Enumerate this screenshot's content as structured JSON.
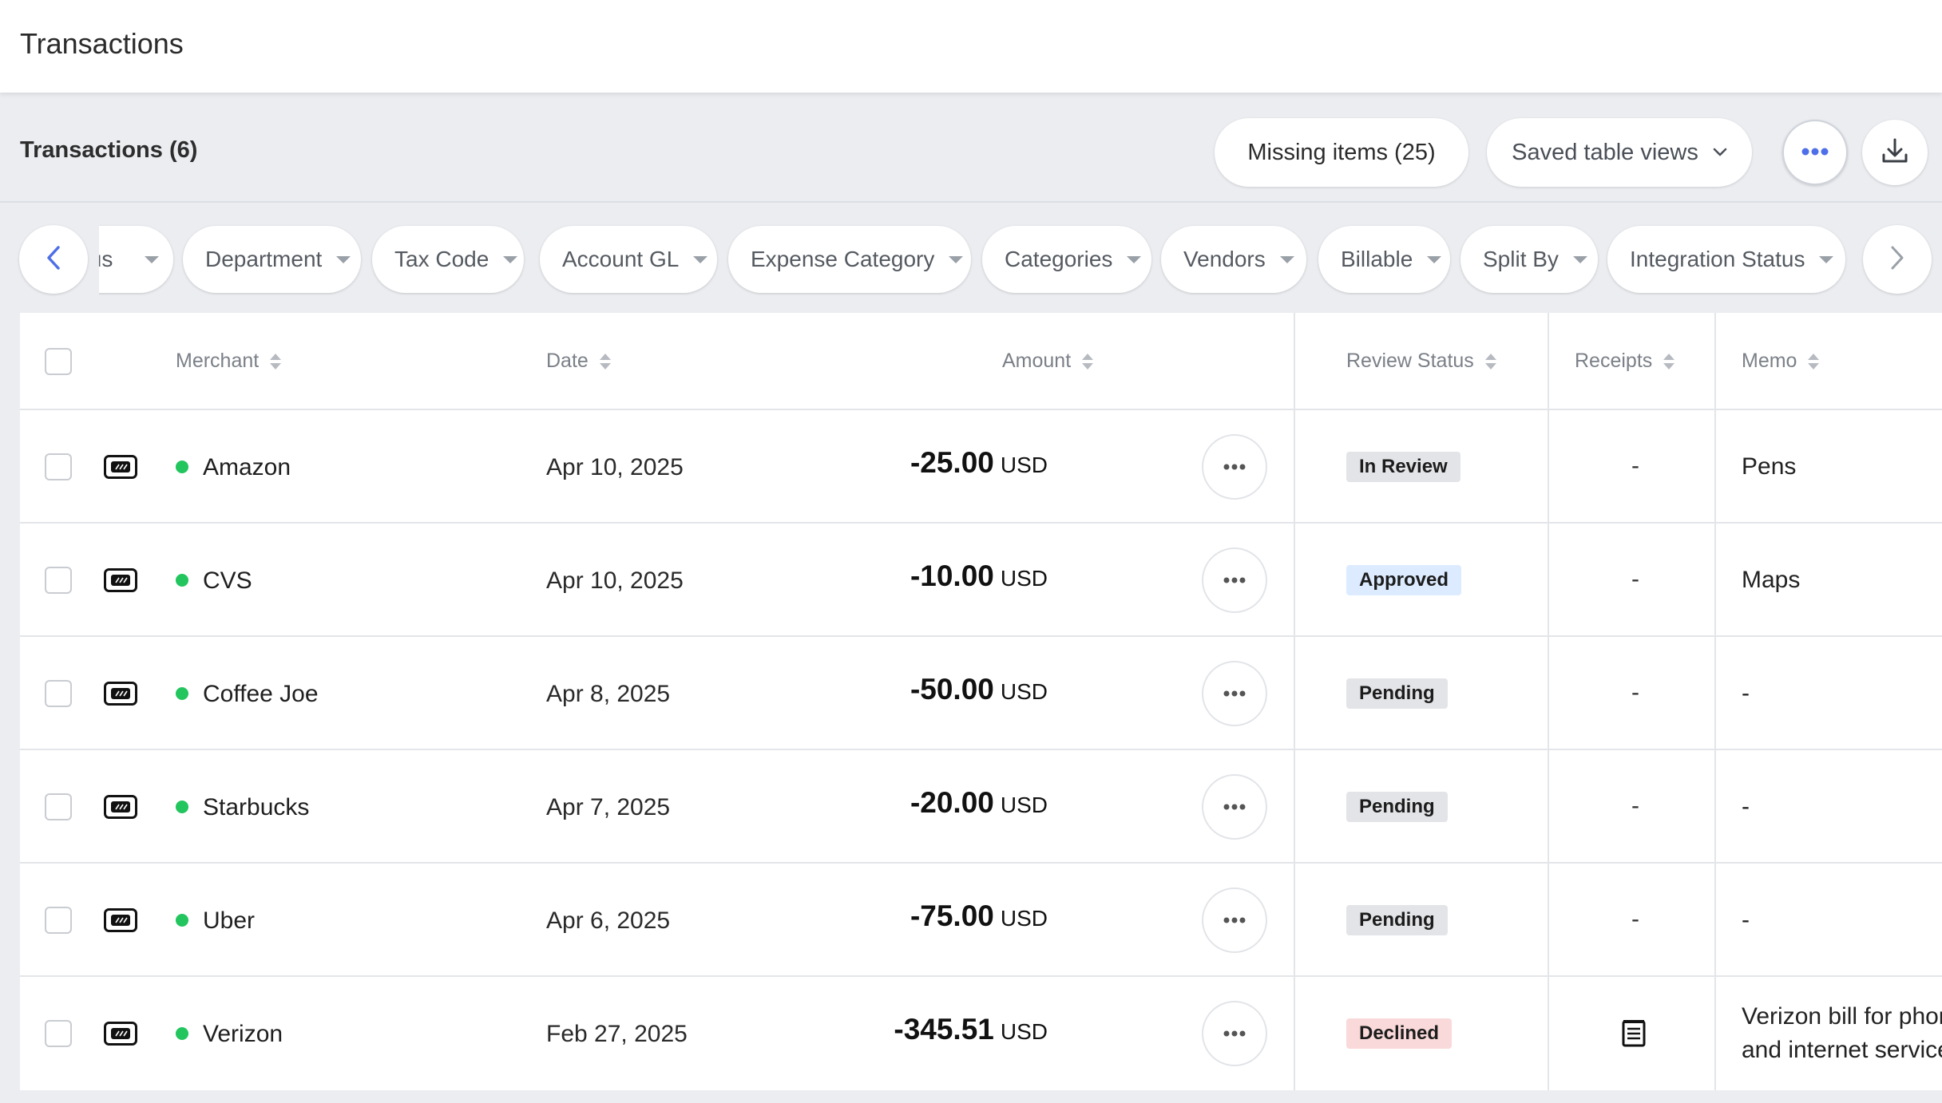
{
  "app": {
    "title": "Transactions"
  },
  "toolbar": {
    "count_label": "Transactions (6)",
    "missing_items_label": "Missing items (25)",
    "saved_views_label": "Saved table views"
  },
  "filters": {
    "chips": [
      "Status",
      "Department",
      "Tax Code",
      "Account GL",
      "Expense Category",
      "Categories",
      "Vendors",
      "Billable",
      "Split By",
      "Integration Status"
    ]
  },
  "table": {
    "headers": {
      "merchant": "Merchant",
      "date": "Date",
      "amount": "Amount",
      "review_status": "Review Status",
      "receipts": "Receipts",
      "memo": "Memo"
    },
    "rows": [
      {
        "merchant": "Amazon",
        "date": "Apr 10, 2025",
        "amount": "-25.00",
        "currency": "USD",
        "status": "In Review",
        "receipt": "-",
        "memo": "Pens",
        "memo2": ""
      },
      {
        "merchant": "CVS",
        "date": "Apr 10, 2025",
        "amount": "-10.00",
        "currency": "USD",
        "status": "Approved",
        "receipt": "-",
        "memo": "Maps",
        "memo2": ""
      },
      {
        "merchant": "Coffee Joe",
        "date": "Apr 8, 2025",
        "amount": "-50.00",
        "currency": "USD",
        "status": "Pending",
        "receipt": "-",
        "memo": "-",
        "memo2": ""
      },
      {
        "merchant": "Starbucks",
        "date": "Apr 7, 2025",
        "amount": "-20.00",
        "currency": "USD",
        "status": "Pending",
        "receipt": "-",
        "memo": "-",
        "memo2": ""
      },
      {
        "merchant": "Uber",
        "date": "Apr 6, 2025",
        "amount": "-75.00",
        "currency": "USD",
        "status": "Pending",
        "receipt": "-",
        "memo": "-",
        "memo2": ""
      },
      {
        "merchant": "Verizon",
        "date": "Feb 27, 2025",
        "amount": "-345.51",
        "currency": "USD",
        "status": "Declined",
        "receipt": "receipt-icon",
        "memo": "Verizon bill for phone",
        "memo2": "and internet service"
      }
    ]
  },
  "colors": {
    "accent": "#4f6fe8",
    "merchant_dot": "#22c55e",
    "status_in_review": "#e3e4e7",
    "status_approved": "#dcebff",
    "status_pending": "#e3e4e7",
    "status_declined": "#f9d9d9"
  },
  "icons": {
    "prev": "chevron-left-icon",
    "next": "chevron-right-icon",
    "more": "more-horizontal-icon",
    "download": "download-icon",
    "card": "card-icon"
  }
}
